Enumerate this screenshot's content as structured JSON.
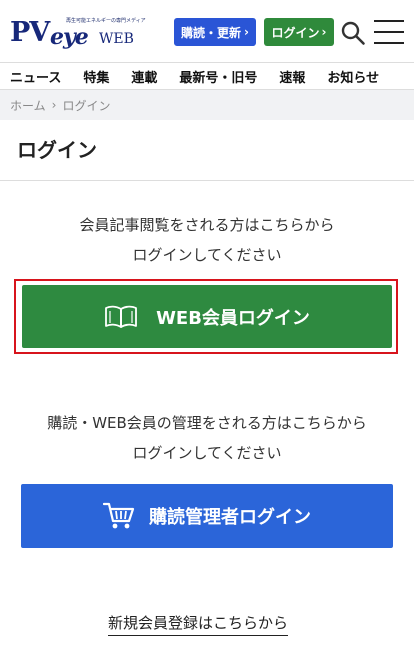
{
  "header": {
    "logo": {
      "tagline": "再生可能エネルギーの専門メディア",
      "pv": "PV",
      "eye": "eye",
      "web": "WEB"
    },
    "subscribe_button": "購読・更新",
    "login_button": "ログイン",
    "arrow": "›"
  },
  "nav": {
    "items": [
      "ニュース",
      "特集",
      "連載",
      "最新号・旧号",
      "速報",
      "お知らせ"
    ]
  },
  "breadcrumb": {
    "home": "ホーム",
    "sep": "›",
    "current": "ログイン"
  },
  "page_title": "ログイン",
  "section1": {
    "line1": "会員記事閲覧をされる方はこちらから",
    "line2": "ログインしてください",
    "button": "WEB会員ログイン",
    "icon": "book-icon"
  },
  "section2": {
    "line1": "購読・WEB会員の管理をされる方はこちらから",
    "line2": "ログインしてください",
    "button": "購読管理者ログイン",
    "icon": "cart-icon"
  },
  "register_link": "新規会員登録はこちらから",
  "colors": {
    "brand_navy": "#17287a",
    "blue": "#2a55d6",
    "green": "#2f8a3b",
    "highlight_red": "#d7141c"
  }
}
